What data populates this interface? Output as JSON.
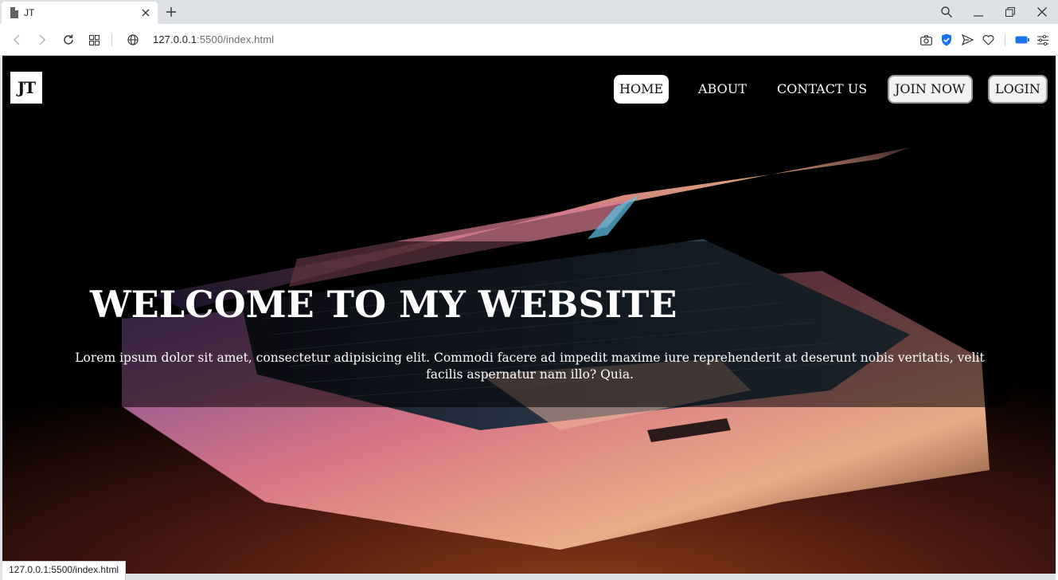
{
  "browser": {
    "tab_title": "JT",
    "url_host": "127.0.0.1",
    "url_rest": ":5500/index.html",
    "status_text": "127.0.0.1:5500/index.html",
    "icons": [
      "page-icon",
      "close-icon",
      "plus-icon",
      "search-icon",
      "minimize-icon",
      "restore-icon",
      "window-close-icon",
      "back-icon",
      "forward-icon",
      "reload-icon",
      "grid-icon",
      "globe-icon",
      "camera-icon",
      "shield-icon",
      "send-icon",
      "heart-icon",
      "battery-icon",
      "settings-icon"
    ]
  },
  "site": {
    "logo": "JT",
    "nav": [
      {
        "label": "HOME"
      },
      {
        "label": "ABOUT"
      },
      {
        "label": "CONTACT US"
      },
      {
        "label": "JOIN NOW"
      },
      {
        "label": "LOGIN"
      }
    ],
    "heading": "WELCOME TO MY WEBSITE",
    "body": "Lorem ipsum dolor sit amet, consectetur adipisicing elit. Commodi facere ad impedit maxime iure reprehenderit at deserunt nobis veritatis, velit facilis aspernatur nam illo? Quia.",
    "colors": {
      "accent_shield": "#1a73e8",
      "nav_active_bg": "#ffffff"
    }
  }
}
